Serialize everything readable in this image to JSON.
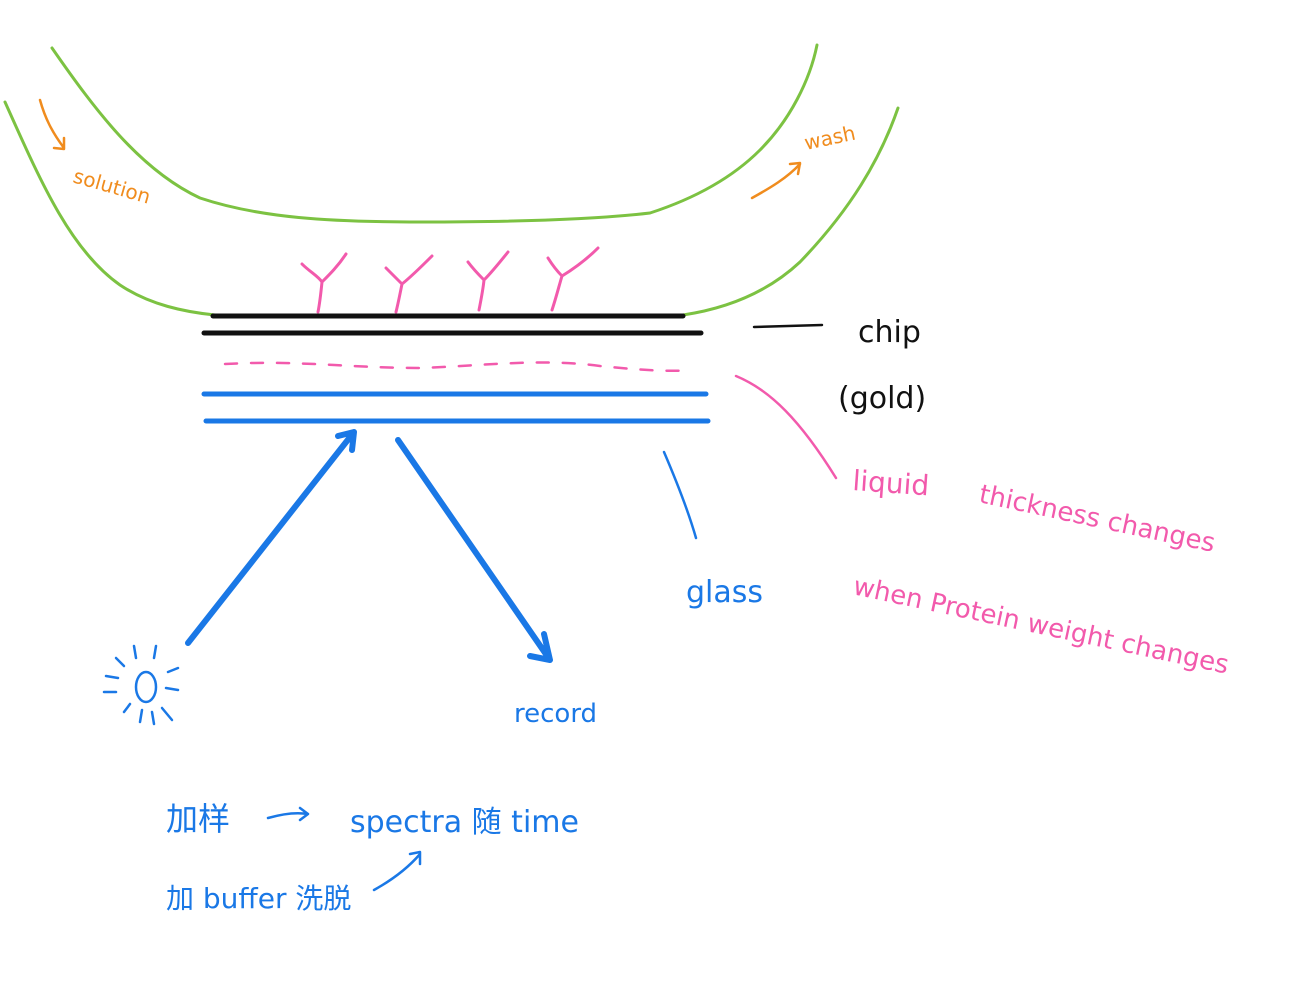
{
  "colors": {
    "flow_cell": "#7cc242",
    "flow_arrow": "#f08c1e",
    "antibody": "#f25aac",
    "chip": "#111111",
    "glass": "#1a78e6",
    "liquid": "#f25aac",
    "note": "#1a78e6"
  },
  "labels": {
    "solution": "solution",
    "wash": "wash",
    "chip": "chip",
    "gold": "(gold)",
    "liquid": "liquid",
    "thickness": "thickness changes",
    "protein": "when Protein weight changes",
    "glass": "glass",
    "record": "record"
  },
  "notes": {
    "line1_left": "加样",
    "line1_right": "spectra 随 time",
    "line2": "加 buffer 洗脱"
  },
  "icons": {
    "light_source": "sun-icon",
    "antibody": "antibody-y-icon"
  }
}
